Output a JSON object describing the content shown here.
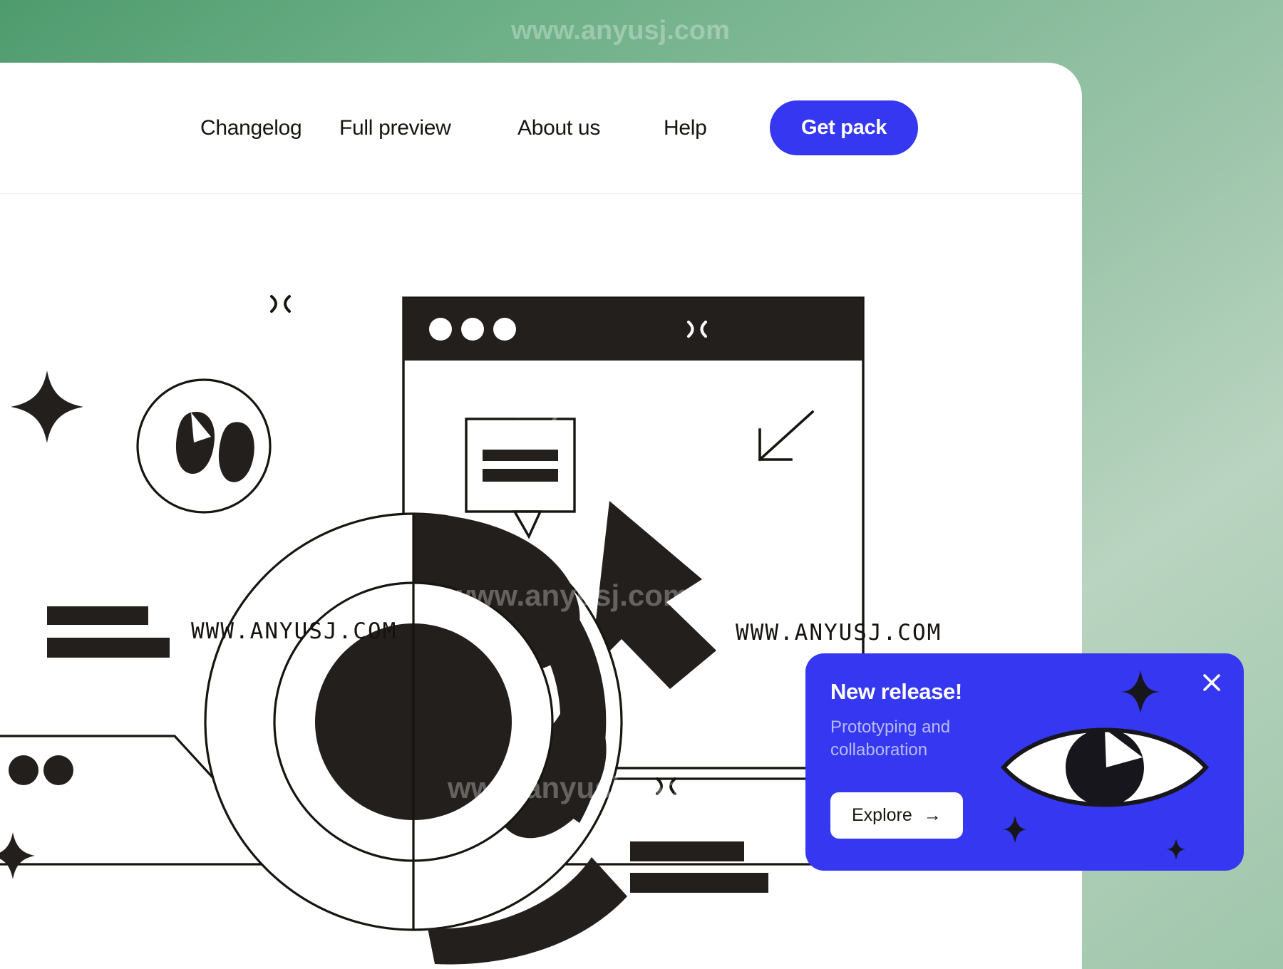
{
  "brand": {
    "accent": "#3538f0",
    "ink": "#17150f",
    "panel_bg": "#ffffff"
  },
  "watermarks": {
    "top": "www.anyusj.com",
    "mid_upper": "www.anyusj.com",
    "mid": "www.anyusj.com",
    "card_area": "www.anyusj.com",
    "lower": "www.anyusj.com",
    "bottom": "www.anyusj.com",
    "dark_left": "WWW.ANYUSJ.COM",
    "dark_card": "WWW.ANYUSJ.COM"
  },
  "nav": {
    "items": [
      {
        "label": "Changelog"
      },
      {
        "label": "Full preview"
      },
      {
        "label": "About us"
      },
      {
        "label": "Help"
      }
    ],
    "cta": {
      "label": "Get pack"
    }
  },
  "illustration": {
    "browser_mockup": {
      "traffic_lights": 3,
      "titlebar_icon": "sparkle-cross-icon"
    },
    "icons": [
      {
        "name": "sparkle-cross-icon"
      },
      {
        "name": "four-point-star-icon"
      },
      {
        "name": "face-circle-icon"
      },
      {
        "name": "cursor-arrow-icon"
      },
      {
        "name": "speech-bubble-icon"
      },
      {
        "name": "diagonal-arrow-icon"
      },
      {
        "name": "loader-ring-icon"
      }
    ]
  },
  "notification": {
    "title": "New release!",
    "subtitle": "Prototyping and collaboration",
    "cta": {
      "label": "Explore",
      "arrow": "→"
    },
    "close_icon": "close-icon",
    "eye_icon": "eye-icon",
    "sparkles": [
      "four-point-star-icon",
      "four-point-star-icon",
      "four-point-star-icon"
    ],
    "bg_color": "#3538f0"
  }
}
